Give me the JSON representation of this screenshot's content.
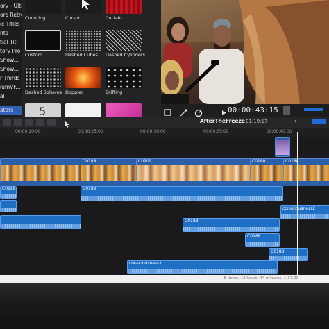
{
  "sidebar": {
    "items": [
      {
        "label": "ory - Ultim"
      },
      {
        "label": "ore Retro"
      },
      {
        "label": "ic Titles"
      },
      {
        "label": "nts"
      },
      {
        "label": "tial Tit"
      },
      {
        "label": "tory Pro"
      },
      {
        "label": "Show..."
      },
      {
        "label": "Show..."
      },
      {
        "label": "r Thirds"
      },
      {
        "label": "iumVF..."
      },
      {
        "label": "al"
      },
      {
        "label": "ators"
      }
    ],
    "selected_index": 11
  },
  "effects": {
    "items": [
      {
        "label": "Counting",
        "color": "#1b1b1b"
      },
      {
        "label": "Cursor",
        "color": "#1d1d1d"
      },
      {
        "label": "Curtain",
        "color": "#b5121b"
      },
      {
        "label": "Custom",
        "color": "#0c0c0c"
      },
      {
        "label": "Dashed Cubes",
        "color": "#2a2a2a"
      },
      {
        "label": "Dashed Cylinders",
        "color": "#3a3a3a"
      },
      {
        "label": "Dashed Spheres",
        "color": "#202020"
      },
      {
        "label": "Doppler",
        "color": "#e85a12"
      },
      {
        "label": "Drifting",
        "color": "#111111"
      },
      {
        "label": "5",
        "color": "#cfcfcf"
      },
      {
        "label": "",
        "color": "#f2f2f2"
      },
      {
        "label": "",
        "color": "#e33aa8"
      }
    ]
  },
  "viewer": {
    "timecode": "00:00:43:15"
  },
  "timeline": {
    "project_name": "AfterTheFreeze",
    "duration": "01:19:17",
    "ruler_ticks": [
      "00:00:20:00",
      "00:00:25:00",
      "00:00:30:00",
      "00:00:35:00",
      "00:00:40:00"
    ],
    "clips": [
      {
        "name": "",
        "kind": "video"
      },
      {
        "name": "C0188",
        "kind": "video"
      },
      {
        "name": "C0209",
        "kind": "video"
      },
      {
        "name": "C0188",
        "kind": "video"
      },
      {
        "name": "C0188",
        "kind": "video"
      },
      {
        "name": "C0188",
        "kind": "audio"
      },
      {
        "name": "C0183",
        "kind": "audio"
      },
      {
        "name": "C0188",
        "kind": "audio"
      },
      {
        "name": "C0188",
        "kind": "audio"
      },
      {
        "name": "C0188",
        "kind": "audio"
      },
      {
        "name": "consciousness2",
        "kind": "audio"
      },
      {
        "name": "consciousness1",
        "kind": "audio"
      }
    ],
    "status_text": "8 items, 13 hours, 44 minutes, 1:17:00"
  }
}
